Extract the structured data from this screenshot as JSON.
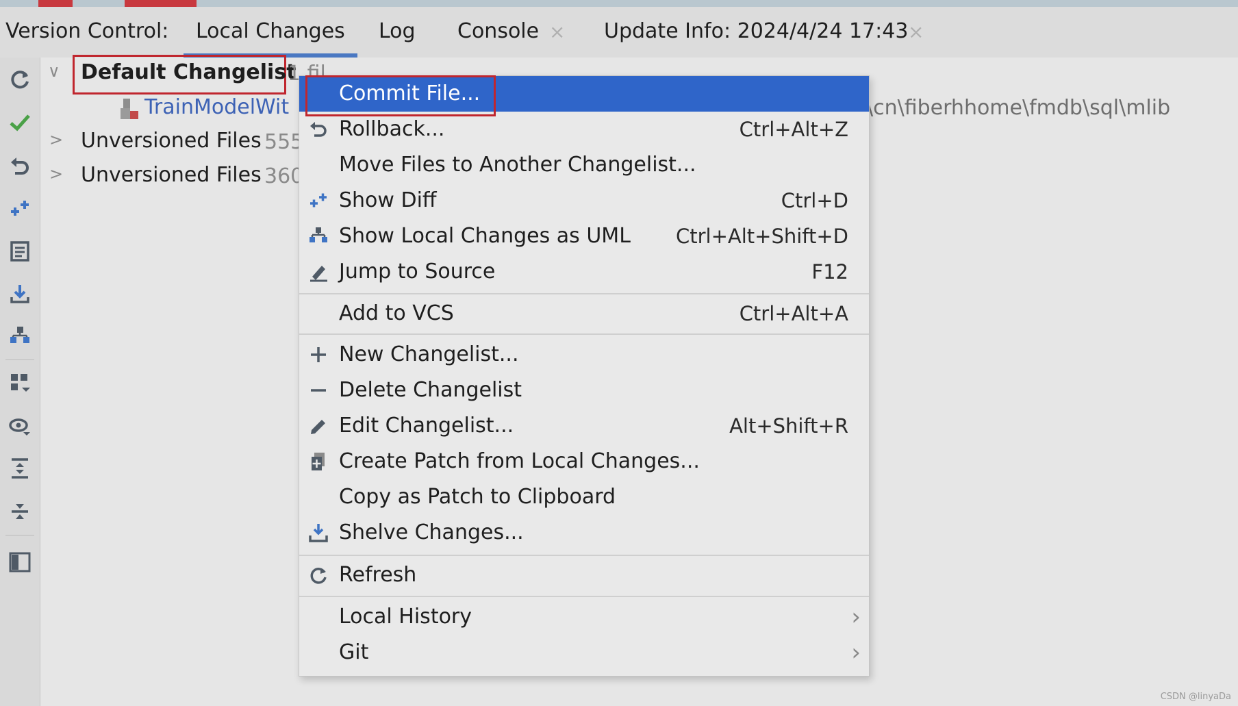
{
  "tabbar": {
    "prefix": "Version Control:",
    "tabs": [
      {
        "label": "Local Changes",
        "active": true
      },
      {
        "label": "Log"
      },
      {
        "label": "Console",
        "closable": true
      },
      {
        "label": "Update Info: 2024/4/24 17:43",
        "closable": true
      }
    ],
    "close_glyph": "×"
  },
  "toolbar": {
    "icons": [
      "refresh-icon",
      "commit-check-icon",
      "rollback-icon",
      "show-diff-icon",
      "changelist-icon",
      "update-icon",
      "uml-icon",
      "group-by-icon",
      "view-options-icon",
      "expand-all-icon",
      "collapse-all-icon",
      "preview-icon"
    ]
  },
  "tree": {
    "changelist": {
      "label": "Default Changelist",
      "count": "1 fil"
    },
    "file": {
      "name": "TrainModelWit"
    },
    "unversioned": [
      {
        "label": "Unversioned Files",
        "count": "555"
      },
      {
        "label": "Unversioned Files",
        "count": "360"
      }
    ],
    "path_fragment": "\\cn\\fiberhhome\\fmdb\\sql\\mlib"
  },
  "menu": {
    "items": [
      {
        "label": "Commit File...",
        "shortcut": "",
        "icon": "none"
      },
      {
        "label": "Rollback...",
        "shortcut": "Ctrl+Alt+Z",
        "icon": "rollback-icon"
      },
      {
        "label": "Move Files to Another Changelist...",
        "shortcut": "",
        "icon": "none"
      },
      {
        "label": "Show Diff",
        "shortcut": "Ctrl+D",
        "icon": "diff-icon"
      },
      {
        "label": "Show Local Changes as UML",
        "shortcut": "Ctrl+Alt+Shift+D",
        "icon": "uml-icon"
      },
      {
        "label": "Jump to Source",
        "shortcut": "F12",
        "icon": "jump-to-source-icon"
      },
      {
        "label": "Add to VCS",
        "shortcut": "Ctrl+Alt+A",
        "icon": "none"
      },
      {
        "label": "New Changelist...",
        "shortcut": "",
        "icon": "plus-icon"
      },
      {
        "label": "Delete Changelist",
        "shortcut": "",
        "icon": "minus-icon"
      },
      {
        "label": "Edit Changelist...",
        "shortcut": "Alt+Shift+R",
        "icon": "pencil-icon"
      },
      {
        "label": "Create Patch from Local Changes...",
        "shortcut": "",
        "icon": "patch-icon"
      },
      {
        "label": "Copy as Patch to Clipboard",
        "shortcut": "",
        "icon": "none"
      },
      {
        "label": "Shelve Changes...",
        "shortcut": "",
        "icon": "shelve-icon"
      },
      {
        "label": "Refresh",
        "shortcut": "",
        "icon": "refresh-icon"
      },
      {
        "label": "Local History",
        "submenu": true,
        "icon": "none"
      },
      {
        "label": "Git",
        "submenu": true,
        "icon": "none"
      }
    ],
    "submenu_glyph": "›"
  },
  "colors": {
    "selection": "#2f65c9",
    "highlight_box": "#c0262e",
    "accent_tab": "#4a78c2"
  },
  "watermark": "CSDN @linyaDa"
}
